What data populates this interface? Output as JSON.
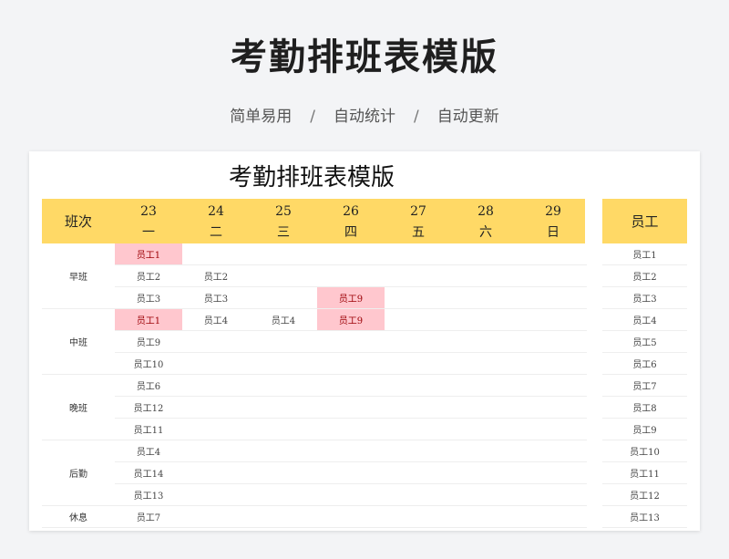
{
  "banner": {
    "title": "考勤排班表模版",
    "taglines": [
      "简单易用",
      "自动统计",
      "自动更新"
    ],
    "separator": "/"
  },
  "sheet": {
    "title": "考勤排班表模版",
    "shift_header": "班次",
    "employee_header": "员工",
    "header_color": "#ffd966",
    "highlight_color": "#ffc7ce",
    "days": [
      {
        "num": "23",
        "weekday": "一"
      },
      {
        "num": "24",
        "weekday": "二"
      },
      {
        "num": "25",
        "weekday": "三"
      },
      {
        "num": "26",
        "weekday": "四"
      },
      {
        "num": "27",
        "weekday": "五"
      },
      {
        "num": "28",
        "weekday": "六"
      },
      {
        "num": "29",
        "weekday": "日"
      }
    ],
    "shifts": [
      {
        "label": "早班",
        "rows": [
          [
            "员工1",
            "",
            "",
            "",
            "",
            "",
            ""
          ],
          [
            "员工2",
            "员工2",
            "",
            "",
            "",
            "",
            ""
          ],
          [
            "员工3",
            "员工3",
            "",
            "员工9",
            "",
            "",
            ""
          ]
        ]
      },
      {
        "label": "中班",
        "rows": [
          [
            "员工1",
            "员工4",
            "员工4",
            "员工9",
            "",
            "",
            ""
          ],
          [
            "员工9",
            "",
            "",
            "",
            "",
            "",
            ""
          ],
          [
            "员工10",
            "",
            "",
            "",
            "",
            "",
            ""
          ]
        ]
      },
      {
        "label": "晚班",
        "rows": [
          [
            "员工6",
            "",
            "",
            "",
            "",
            "",
            ""
          ],
          [
            "员工12",
            "",
            "",
            "",
            "",
            "",
            ""
          ],
          [
            "员工11",
            "",
            "",
            "",
            "",
            "",
            ""
          ]
        ]
      },
      {
        "label": "后勤",
        "rows": [
          [
            "员工4",
            "",
            "",
            "",
            "",
            "",
            ""
          ],
          [
            "员工14",
            "",
            "",
            "",
            "",
            "",
            ""
          ],
          [
            "员工13",
            "",
            "",
            "",
            "",
            "",
            ""
          ]
        ]
      },
      {
        "label": "休息",
        "rows": [
          [
            "员工7",
            "",
            "",
            "",
            "",
            "",
            ""
          ]
        ]
      }
    ],
    "highlighted_cells": [
      [
        0,
        0
      ],
      [
        2,
        3
      ],
      [
        3,
        0
      ],
      [
        3,
        3
      ]
    ],
    "employees": [
      "员工1",
      "员工2",
      "员工3",
      "员工4",
      "员工5",
      "员工6",
      "员工7",
      "员工8",
      "员工9",
      "员工10",
      "员工11",
      "员工12",
      "员工13"
    ]
  }
}
